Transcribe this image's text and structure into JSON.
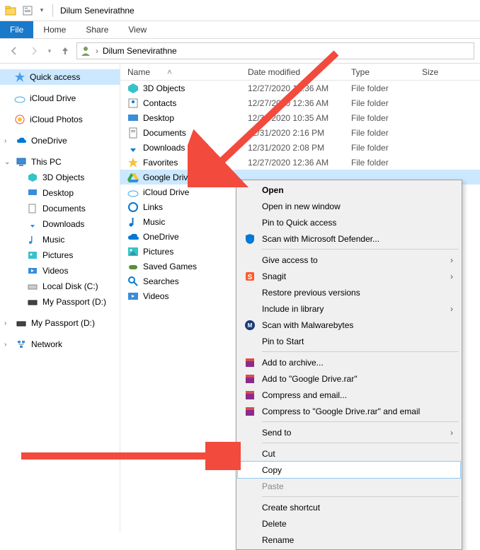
{
  "title": "Dilum Senevirathne",
  "menu": {
    "file": "File",
    "home": "Home",
    "share": "Share",
    "view": "View"
  },
  "breadcrumb": {
    "chevron": "›",
    "name": "Dilum Senevirathne"
  },
  "columns": {
    "name": "Name",
    "date": "Date modified",
    "type": "Type",
    "size": "Size",
    "sort_arrow": "˄"
  },
  "sidebar": {
    "quick": "Quick access",
    "icloud_drive": "iCloud Drive",
    "icloud_photos": "iCloud Photos",
    "onedrive": "OneDrive",
    "this_pc": "This PC",
    "pc": {
      "objects3d": "3D Objects",
      "desktop": "Desktop",
      "documents": "Documents",
      "downloads": "Downloads",
      "music": "Music",
      "pictures": "Pictures",
      "videos": "Videos",
      "localdisk": "Local Disk (C:)",
      "passport": "My Passport (D:)"
    },
    "passport2": "My Passport (D:)",
    "network": "Network"
  },
  "files": [
    {
      "name": "3D Objects",
      "date": "12/27/2020 12:36 AM",
      "type": "File folder",
      "icon": "cube"
    },
    {
      "name": "Contacts",
      "date": "12/27/2020 12:36 AM",
      "type": "File folder",
      "icon": "contacts"
    },
    {
      "name": "Desktop",
      "date": "12/31/2020 10:35 AM",
      "type": "File folder",
      "icon": "desktop"
    },
    {
      "name": "Documents",
      "date": "12/31/2020 2:16 PM",
      "type": "File folder",
      "icon": "doc"
    },
    {
      "name": "Downloads",
      "date": "12/31/2020 2:08 PM",
      "type": "File folder",
      "icon": "down"
    },
    {
      "name": "Favorites",
      "date": "12/27/2020 12:36 AM",
      "type": "File folder",
      "icon": "star"
    },
    {
      "name": "Google Drive",
      "date": "",
      "type": "",
      "icon": "gdrive",
      "selected": true
    },
    {
      "name": "iCloud Drive",
      "date": "",
      "type": "",
      "icon": "icloud"
    },
    {
      "name": "Links",
      "date": "",
      "type": "",
      "icon": "link"
    },
    {
      "name": "Music",
      "date": "",
      "type": "",
      "icon": "music"
    },
    {
      "name": "OneDrive",
      "date": "",
      "type": "",
      "icon": "onedrive"
    },
    {
      "name": "Pictures",
      "date": "",
      "type": "",
      "icon": "pic"
    },
    {
      "name": "Saved Games",
      "date": "",
      "type": "",
      "icon": "games"
    },
    {
      "name": "Searches",
      "date": "",
      "type": "",
      "icon": "search"
    },
    {
      "name": "Videos",
      "date": "",
      "type": "",
      "icon": "video"
    }
  ],
  "ctx": {
    "open": "Open",
    "openwin": "Open in new window",
    "pinq": "Pin to Quick access",
    "defender": "Scan with Microsoft Defender...",
    "give": "Give access to",
    "snagit": "Snagit",
    "restore": "Restore previous versions",
    "include": "Include in library",
    "malware": "Scan with Malwarebytes",
    "pinstart": "Pin to Start",
    "addarchive": "Add to archive...",
    "addrar": "Add to \"Google Drive.rar\"",
    "compressemail": "Compress and email...",
    "compressraremail": "Compress to \"Google Drive.rar\" and email",
    "sendto": "Send to",
    "cut": "Cut",
    "copy": "Copy",
    "paste": "Paste",
    "shortcut": "Create shortcut",
    "delete": "Delete",
    "rename": "Rename"
  }
}
